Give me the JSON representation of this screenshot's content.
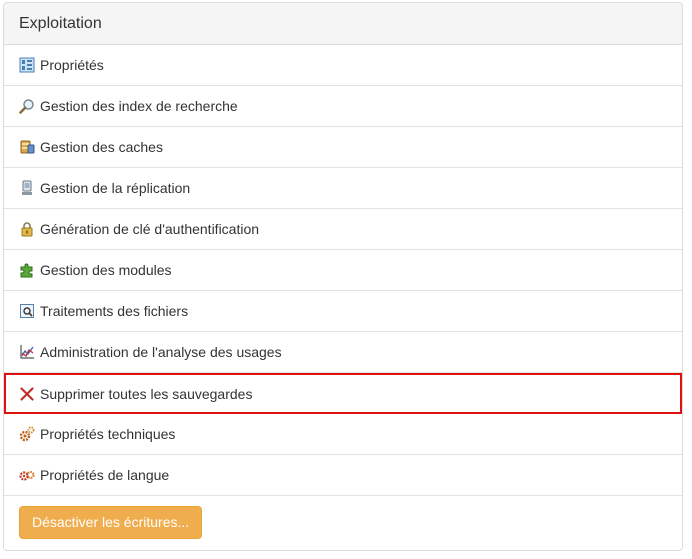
{
  "panel": {
    "title": "Exploitation",
    "items": [
      {
        "label": "Propriétés",
        "icon": "properties-icon"
      },
      {
        "label": "Gestion des index de recherche",
        "icon": "magnifier-icon"
      },
      {
        "label": "Gestion des caches",
        "icon": "database-icon"
      },
      {
        "label": "Gestion de la réplication",
        "icon": "replication-icon"
      },
      {
        "label": "Génération de clé d'authentification",
        "icon": "lock-icon"
      },
      {
        "label": "Gestion des modules",
        "icon": "puzzle-icon"
      },
      {
        "label": "Traitements des fichiers",
        "icon": "file-search-icon"
      },
      {
        "label": "Administration de l'analyse des usages",
        "icon": "chart-icon"
      },
      {
        "label": "Supprimer toutes les sauvegardes",
        "icon": "delete-x-icon"
      },
      {
        "label": "Propriétés techniques",
        "icon": "gears-icon"
      },
      {
        "label": "Propriétés de langue",
        "icon": "language-gears-icon"
      }
    ],
    "button_label": "Désactiver les écritures..."
  },
  "colors": {
    "highlight_border": "#e01010",
    "button_bg": "#f0ad4e",
    "heading_bg": "#f5f5f5"
  }
}
